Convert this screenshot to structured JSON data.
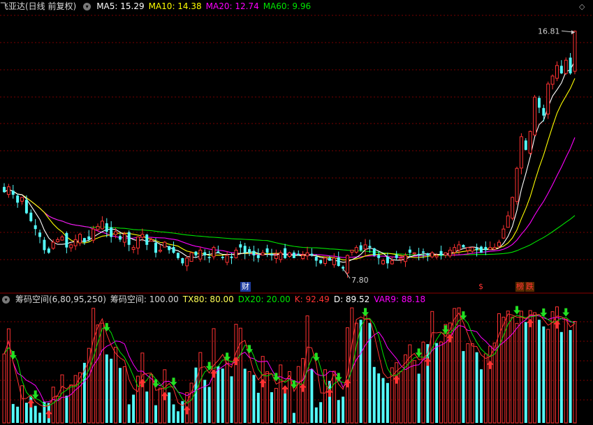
{
  "colors": {
    "up": "#ff3232",
    "down": "#54fcfc",
    "ma5": "#ffffff",
    "ma10": "#ffff00",
    "ma20": "#ff00ff",
    "ma60": "#00e600",
    "tx80": "#ffff54",
    "dx20": "#00e600",
    "k": "#ff3232",
    "d": "#ffffff",
    "var9": "#ff00ff",
    "grid": "#7a0000"
  },
  "main_panel": {
    "title": "飞亚达(日线 前复权)",
    "ma5_label": "MA5: 15.29",
    "ma10_label": "MA10: 14.38",
    "ma20_label": "MA20: 12.74",
    "ma60_label": "MA60: 9.96",
    "high_label": "16.81",
    "low_label": "7.80",
    "marker_cai": "财",
    "marker_dollar": "$",
    "marker_rank": "榜",
    "marker_die": "跌",
    "diamond": "◇"
  },
  "sub_panel": {
    "title": "筹码空间(6,80,95,250)",
    "label_main": "筹码空间: 100.00",
    "label_tx80": "TX80: 80.00",
    "label_dx20": "DX20: 20.00",
    "label_k": "K: 92.49",
    "label_d": "D: 89.52",
    "label_var9": "VAR9: 88.18"
  },
  "chart_data": [
    {
      "type": "candlestick",
      "title": "飞亚达(日线 前复权)",
      "series": [
        {
          "name": "MA5",
          "last": 15.29
        },
        {
          "name": "MA10",
          "last": 14.38
        },
        {
          "name": "MA20",
          "last": 12.74
        },
        {
          "name": "MA60",
          "last": 9.96
        }
      ],
      "annotations": {
        "high": 16.81,
        "low": 7.8
      },
      "ylim": [
        7.4,
        17.4
      ],
      "close": [
        10.7,
        10.9,
        10.6,
        10.3,
        10.5,
        9.9,
        9.6,
        9.3,
        9.0,
        8.5,
        8.4,
        8.8,
        8.9,
        9.0,
        8.6,
        8.7,
        8.9,
        9.1,
        8.8,
        8.9,
        9.3,
        9.4,
        9.6,
        9.2,
        9.0,
        9.2,
        8.9,
        9.1,
        8.7,
        8.6,
        9.0,
        9.1,
        8.7,
        8.9,
        8.4,
        8.5,
        8.8,
        8.5,
        8.4,
        8.2,
        8.0,
        8.2,
        8.4,
        8.3,
        8.5,
        8.3,
        8.2,
        8.6,
        8.4,
        8.2,
        8.3,
        8.2,
        8.5,
        8.6,
        8.4,
        8.4,
        8.3,
        8.2,
        8.4,
        8.4,
        8.3,
        8.3,
        8.4,
        8.2,
        8.4,
        8.2,
        8.3,
        8.3,
        8.4,
        8.3,
        8.1,
        8.0,
        8.2,
        8.1,
        8.2,
        7.9,
        7.8,
        8.3,
        8.5,
        8.6,
        8.5,
        8.7,
        8.6,
        8.3,
        8.2,
        8.1,
        8.0,
        8.1,
        8.2,
        8.2,
        8.3,
        8.4,
        8.4,
        8.3,
        8.4,
        8.3,
        8.4,
        8.3,
        8.3,
        8.4,
        8.5,
        8.6,
        8.7,
        8.6,
        8.6,
        8.6,
        8.5,
        8.4,
        8.5,
        8.6,
        8.6,
        8.8,
        9.3,
        9.8,
        10.5,
        11.6,
        12.8,
        12.3,
        13.0,
        14.3,
        13.9,
        13.6,
        14.8,
        15.1,
        15.5,
        15.2,
        15.7,
        15.2,
        16.8
      ]
    },
    {
      "type": "bar",
      "title": "筹码空间(6,80,95,250)",
      "series": [
        {
          "name": "筹码空间",
          "last": 100.0
        },
        {
          "name": "TX80",
          "last": 80.0
        },
        {
          "name": "DX20",
          "last": 20.0
        },
        {
          "name": "K",
          "last": 92.49
        },
        {
          "name": "D",
          "last": 89.52
        },
        {
          "name": "VAR9",
          "last": 88.18
        }
      ],
      "ylim": [
        0,
        100
      ]
    }
  ]
}
